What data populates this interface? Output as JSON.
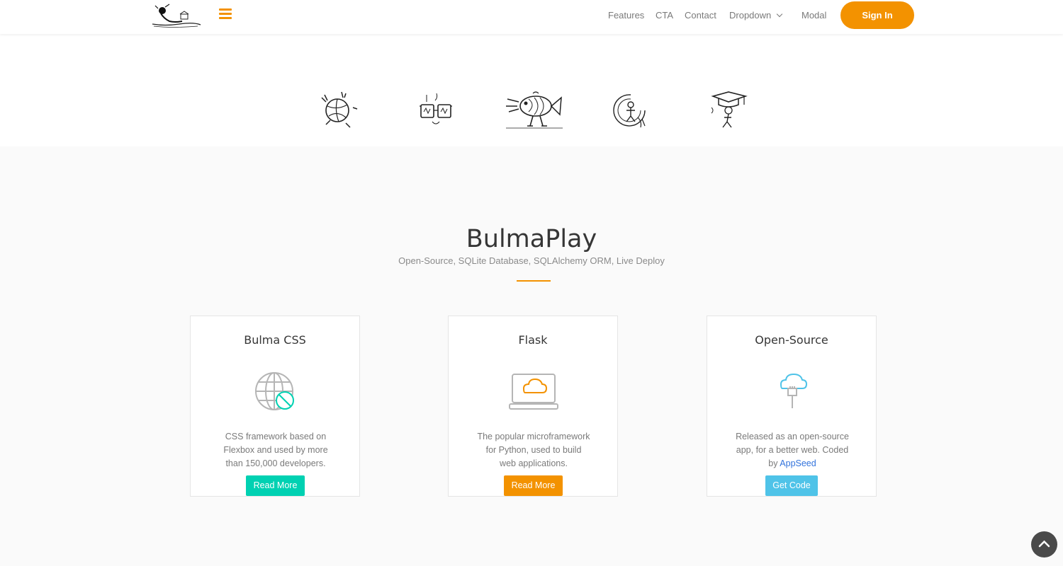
{
  "navbar": {
    "logo_icon": "surfer-logo-icon",
    "menu_icon": "hamburger-menu-icon",
    "items": [
      {
        "label": "Features"
      },
      {
        "label": "CTA"
      },
      {
        "label": "Contact"
      },
      {
        "label": "Dropdown"
      },
      {
        "label": "Modal"
      }
    ],
    "signin_label": "Sign In",
    "accent_color": "#f39200"
  },
  "hero": {
    "clients": [
      {
        "icon": "volleyball-character-icon"
      },
      {
        "icon": "glasses-character-icon"
      },
      {
        "icon": "walking-fish-icon"
      },
      {
        "icon": "surfer-wave-icon"
      },
      {
        "icon": "graduation-cap-character-icon"
      }
    ]
  },
  "section": {
    "title": "BulmaPlay",
    "subtitle": "Open-Source, SQLite Database, SQLAlchemy ORM, Live Deploy"
  },
  "cards": [
    {
      "title": "Bulma CSS",
      "icon": "globe-mouse-icon",
      "text": "CSS framework based on Flexbox and used by more than 150,000 developers.",
      "button": "Read More",
      "button_color": "#00d1b2"
    },
    {
      "title": "Flask",
      "icon": "laptop-cloud-icon",
      "text": "The popular microframework for Python, used to build web applications.",
      "button": "Read More",
      "button_color": "#f39200"
    },
    {
      "title": "Open-Source",
      "icon": "cloud-plug-icon",
      "text": "Released as an open-source app, for a better web. Coded by ",
      "link": "AppSeed",
      "button": "Get Code",
      "button_color": "#4fc3e8"
    }
  ],
  "scroll_top_icon": "chevron-up-icon"
}
